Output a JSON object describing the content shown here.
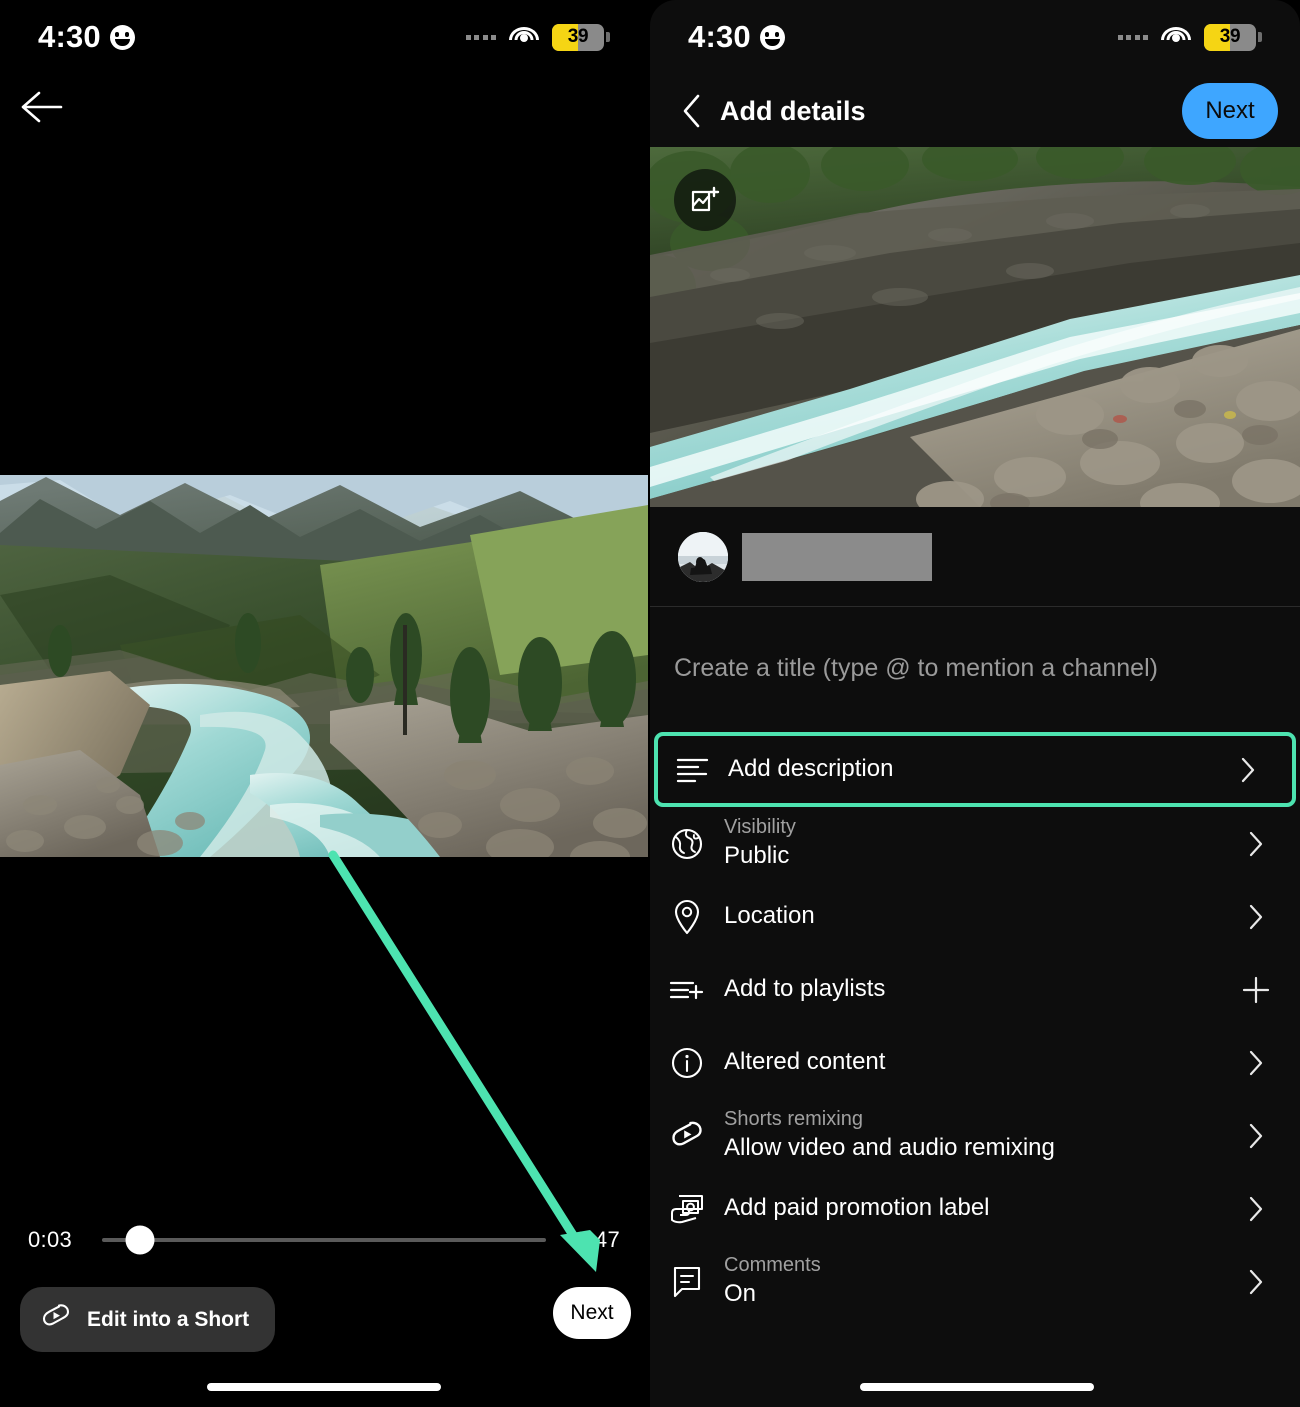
{
  "status_bar": {
    "time": "4:30",
    "battery_percent": "39",
    "icons": [
      "smiley-face-icon",
      "signal-dots-icon",
      "wifi-icon",
      "battery-icon"
    ]
  },
  "left_panel": {
    "name": "video-preview-editor",
    "back_icon": "back-arrow-icon",
    "scrubber": {
      "current_time": "0:03",
      "total_time": "0:47",
      "position_percent": 8.5
    },
    "edit_short_button": {
      "label": "Edit into a Short",
      "icon": "shorts-icon"
    },
    "next_button": {
      "label": "Next"
    }
  },
  "annotation": {
    "type": "arrow",
    "color": "#4de3b0",
    "points_to": "next-button-left"
  },
  "right_panel": {
    "header": {
      "back_icon": "chevron-left-icon",
      "title": "Add details",
      "next_label": "Next",
      "next_color": "#3ea6ff"
    },
    "video_preview": {
      "thumbnail_button_icon": "add-image-icon"
    },
    "channel": {
      "avatar_icon": "channel-avatar",
      "name_redacted": true
    },
    "title_input": {
      "placeholder": "Create a title (type @ to mention a channel)",
      "value": ""
    },
    "settings": [
      {
        "name": "add-description",
        "icon": "description-lines-icon",
        "sub": "",
        "main": "Add description",
        "action_icon": "chevron-right-icon",
        "highlighted": true,
        "highlight_color": "#4de3b0"
      },
      {
        "name": "visibility",
        "icon": "globe-icon",
        "sub": "Visibility",
        "main": "Public",
        "action_icon": "chevron-right-icon",
        "highlighted": false
      },
      {
        "name": "location",
        "icon": "location-pin-icon",
        "sub": "",
        "main": "Location",
        "action_icon": "chevron-right-icon",
        "highlighted": false
      },
      {
        "name": "add-to-playlists",
        "icon": "playlist-add-icon",
        "sub": "",
        "main": "Add to playlists",
        "action_icon": "plus-icon",
        "highlighted": false
      },
      {
        "name": "altered-content",
        "icon": "info-circle-icon",
        "sub": "",
        "main": "Altered content",
        "action_icon": "chevron-right-icon",
        "highlighted": false
      },
      {
        "name": "shorts-remixing",
        "icon": "shorts-icon",
        "sub": "Shorts remixing",
        "main": "Allow video and audio remixing",
        "action_icon": "chevron-right-icon",
        "highlighted": false
      },
      {
        "name": "add-paid-promotion-label",
        "icon": "paid-promotion-icon",
        "sub": "",
        "main": "Add paid promotion label",
        "action_icon": "chevron-right-icon",
        "highlighted": false
      },
      {
        "name": "comments",
        "icon": "comment-bubble-icon",
        "sub": "Comments",
        "main": "On",
        "action_icon": "chevron-right-icon",
        "highlighted": false
      }
    ]
  }
}
